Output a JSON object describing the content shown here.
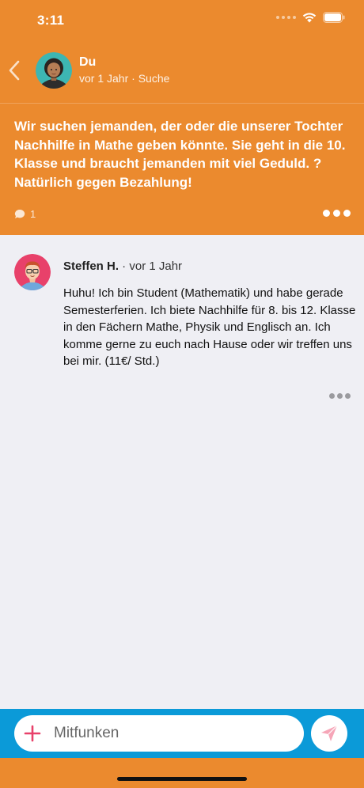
{
  "status_bar": {
    "time": "3:11"
  },
  "post": {
    "author": "Du",
    "meta": "vor 1 Jahr · Suche",
    "text": "Wir suchen jemanden, der oder die unserer Tochter Nachhilfe in Mathe geben könnte. Sie geht in die 10. Klasse und braucht jemanden mit viel Geduld. ? Natürlich gegen Bezahlung!",
    "comment_count": "1"
  },
  "comment": {
    "author": "Steffen H.",
    "meta": " · vor 1 Jahr",
    "text": "Huhu! Ich bin Student (Mathematik) und habe gerade Semesterferien. Ich biete Nachhilfe für 8. bis 12. Klasse in den Fächern Mathe, Physik und Englisch an. Ich komme gerne zu euch nach Hause oder wir treffen uns bei mir. (11€/ Std.)"
  },
  "composer": {
    "placeholder": "Mitfunken"
  },
  "colors": {
    "header_orange": "#eb8a2e",
    "input_bar_blue": "#0b9ad8",
    "accent_pink": "#e8416a",
    "background": "#efeff4"
  },
  "icons": [
    "back-chevron-icon",
    "wifi-icon",
    "battery-icon",
    "comment-bubble-icon",
    "more-dots-icon",
    "plus-icon",
    "send-icon"
  ]
}
